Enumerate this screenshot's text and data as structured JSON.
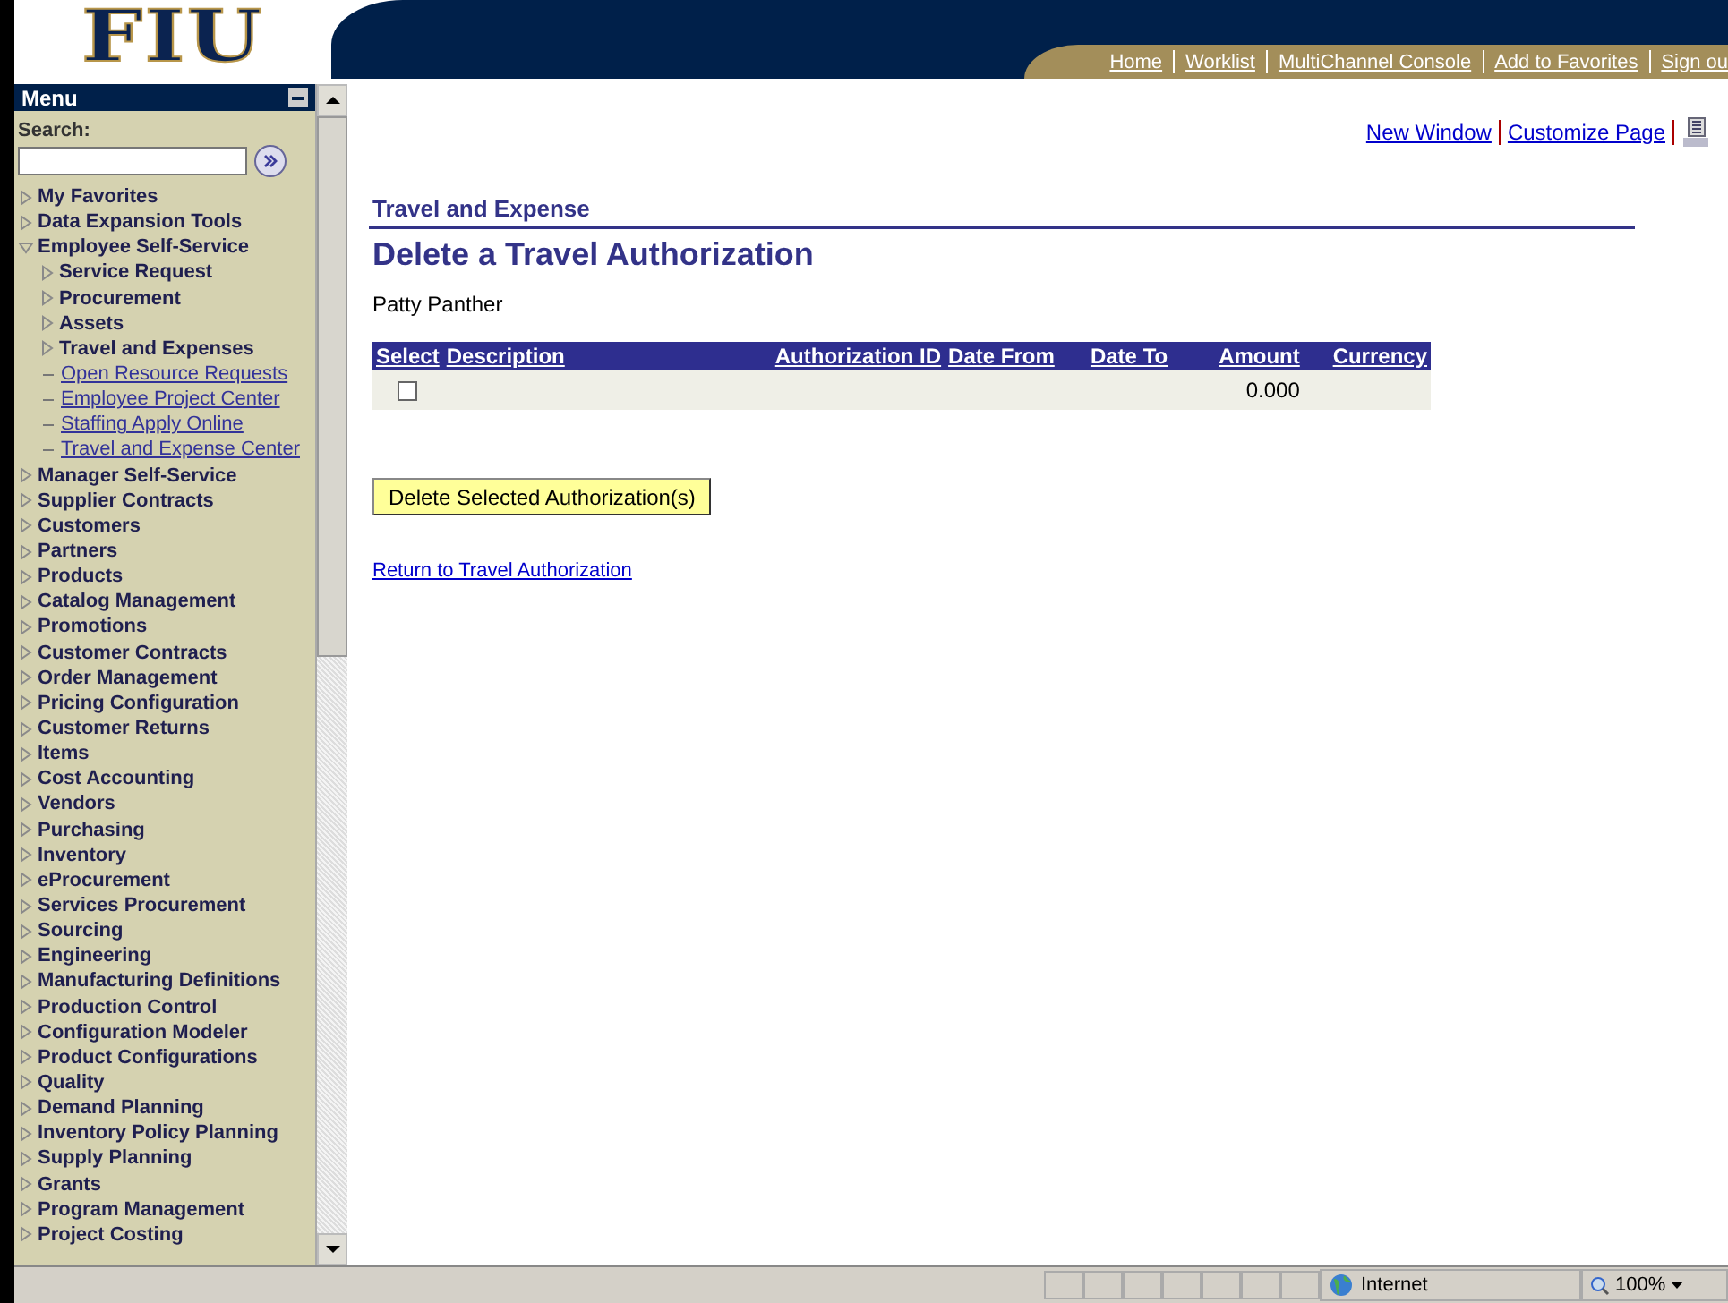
{
  "header": {
    "logo": "FIU",
    "nav_links": [
      "Home",
      "Worklist",
      "MultiChannel Console",
      "Add to Favorites",
      "Sign ou"
    ]
  },
  "menu": {
    "title": "Menu",
    "search_label": "Search:",
    "items": [
      {
        "label": "My Favorites",
        "kind": "folder",
        "expanded": false
      },
      {
        "label": "Data Expansion Tools",
        "kind": "folder",
        "expanded": false
      },
      {
        "label": "Employee Self-Service",
        "kind": "folder",
        "expanded": true,
        "children": [
          {
            "label": "Service Request",
            "kind": "folder",
            "expanded": false
          },
          {
            "label": "Procurement",
            "kind": "folder",
            "expanded": false
          },
          {
            "label": "Assets",
            "kind": "folder",
            "expanded": false
          },
          {
            "label": "Travel and Expenses",
            "kind": "folder",
            "expanded": false
          },
          {
            "label": "Open Resource Requests",
            "kind": "link"
          },
          {
            "label": "Employee Project Center",
            "kind": "link"
          },
          {
            "label": "Staffing Apply Online",
            "kind": "link"
          },
          {
            "label": "Travel and Expense Center",
            "kind": "link"
          }
        ]
      },
      {
        "label": "Manager Self-Service",
        "kind": "folder",
        "expanded": false
      },
      {
        "label": "Supplier Contracts",
        "kind": "folder",
        "expanded": false
      },
      {
        "label": "Customers",
        "kind": "folder",
        "expanded": false
      },
      {
        "label": "Partners",
        "kind": "folder",
        "expanded": false
      },
      {
        "label": "Products",
        "kind": "folder",
        "expanded": false
      },
      {
        "label": "Catalog Management",
        "kind": "folder",
        "expanded": false
      },
      {
        "label": "Promotions",
        "kind": "folder",
        "expanded": false
      },
      {
        "label": "Customer Contracts",
        "kind": "folder",
        "expanded": false
      },
      {
        "label": "Order Management",
        "kind": "folder",
        "expanded": false
      },
      {
        "label": "Pricing Configuration",
        "kind": "folder",
        "expanded": false
      },
      {
        "label": "Customer Returns",
        "kind": "folder",
        "expanded": false
      },
      {
        "label": "Items",
        "kind": "folder",
        "expanded": false
      },
      {
        "label": "Cost Accounting",
        "kind": "folder",
        "expanded": false
      },
      {
        "label": "Vendors",
        "kind": "folder",
        "expanded": false
      },
      {
        "label": "Purchasing",
        "kind": "folder",
        "expanded": false
      },
      {
        "label": "Inventory",
        "kind": "folder",
        "expanded": false
      },
      {
        "label": "eProcurement",
        "kind": "folder",
        "expanded": false
      },
      {
        "label": "Services Procurement",
        "kind": "folder",
        "expanded": false
      },
      {
        "label": "Sourcing",
        "kind": "folder",
        "expanded": false
      },
      {
        "label": "Engineering",
        "kind": "folder",
        "expanded": false
      },
      {
        "label": "Manufacturing Definitions",
        "kind": "folder",
        "expanded": false
      },
      {
        "label": "Production Control",
        "kind": "folder",
        "expanded": false
      },
      {
        "label": "Configuration Modeler",
        "kind": "folder",
        "expanded": false
      },
      {
        "label": "Product Configurations",
        "kind": "folder",
        "expanded": false
      },
      {
        "label": "Quality",
        "kind": "folder",
        "expanded": false
      },
      {
        "label": "Demand Planning",
        "kind": "folder",
        "expanded": false
      },
      {
        "label": "Inventory Policy Planning",
        "kind": "folder",
        "expanded": false
      },
      {
        "label": "Supply Planning",
        "kind": "folder",
        "expanded": false
      },
      {
        "label": "Grants",
        "kind": "folder",
        "expanded": false
      },
      {
        "label": "Program Management",
        "kind": "folder",
        "expanded": false
      },
      {
        "label": "Project Costing",
        "kind": "folder",
        "expanded": false
      }
    ]
  },
  "page_links": [
    "New Window",
    "Customize Page"
  ],
  "section_title": "Travel and Expense",
  "page_title": "Delete a Travel Authorization",
  "employee_name": "Patty Panther",
  "table": {
    "columns": [
      "Select",
      "Description",
      "Authorization ID",
      "Date From",
      "Date To",
      "Amount",
      "Currency"
    ],
    "rows": [
      {
        "checked": false,
        "description": "",
        "authorization_id": "",
        "date_from": "",
        "date_to": "",
        "amount": "0.000",
        "currency": ""
      }
    ]
  },
  "delete_button": "Delete Selected Authorization(s)",
  "return_link": "Return to Travel Authorization",
  "status_bar": {
    "zone": "Internet",
    "zoom": "100%"
  }
}
